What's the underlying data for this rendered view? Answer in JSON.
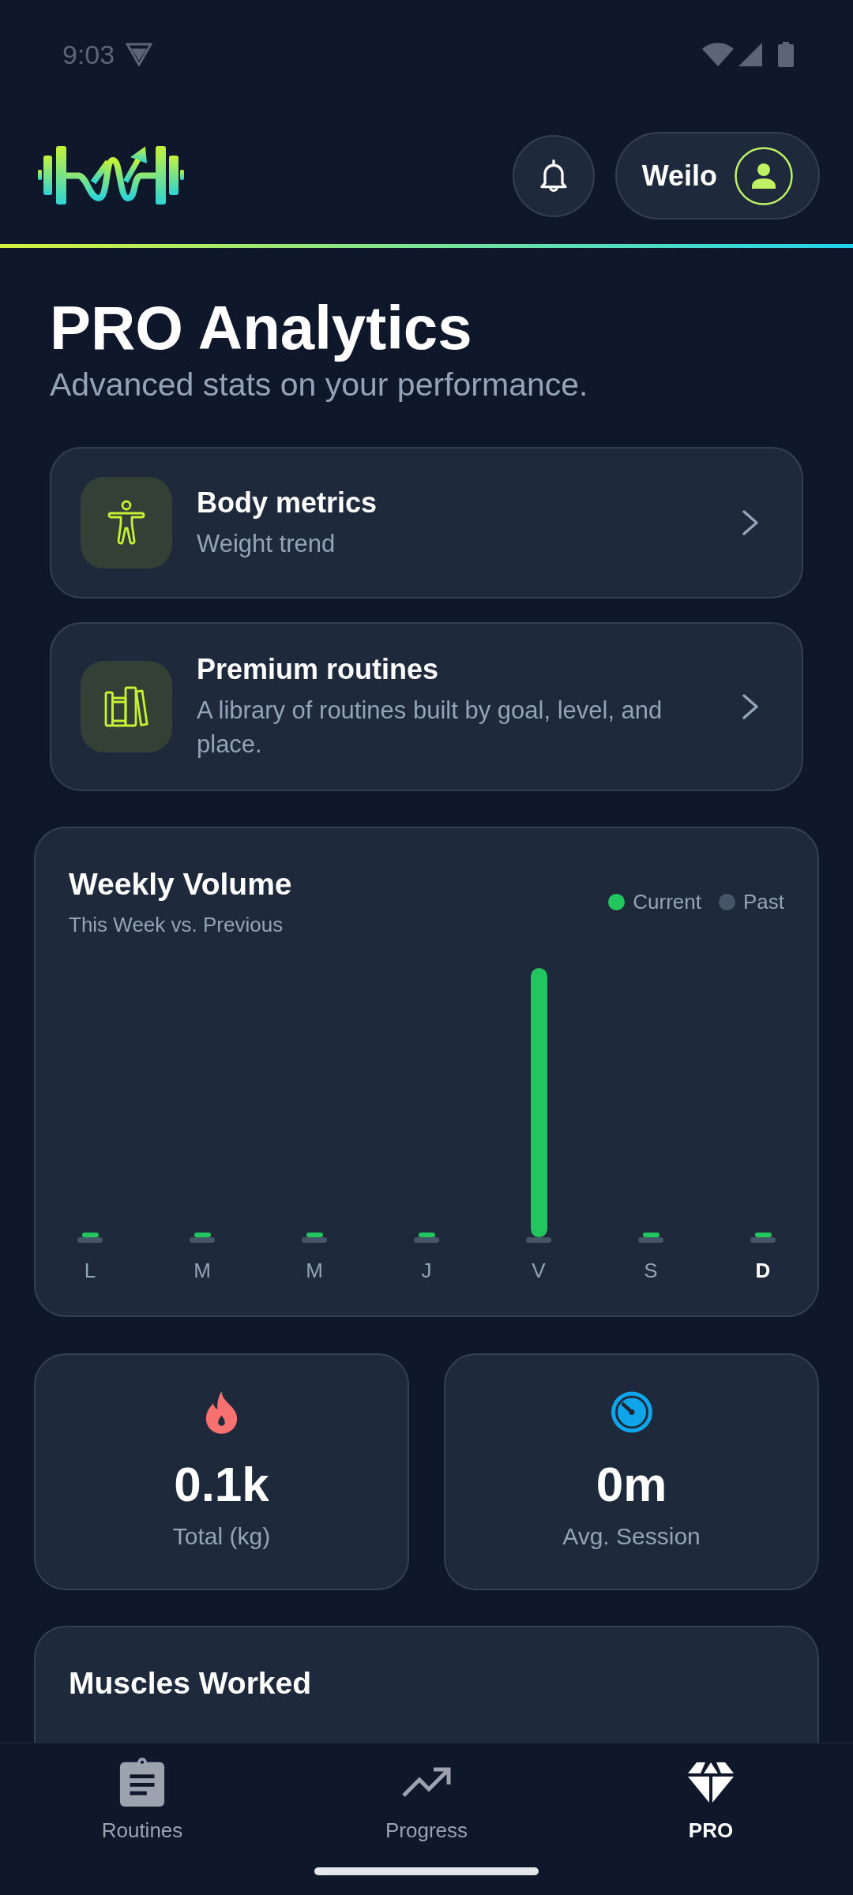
{
  "status_bar": {
    "time": "9:03"
  },
  "header": {
    "user_name": "Weilo"
  },
  "page": {
    "title": "PRO Analytics",
    "subtitle": "Advanced stats on your performance."
  },
  "features": [
    {
      "kind": "body",
      "title": "Body metrics",
      "subtitle": "Weight trend"
    },
    {
      "kind": "library",
      "title": "Premium routines",
      "subtitle": "A library of routines built by goal, level, and place."
    }
  ],
  "weekly_volume": {
    "title": "Weekly Volume",
    "subtitle": "This Week vs. Previous",
    "legend": [
      {
        "label": "Current",
        "color": "#22c55e"
      },
      {
        "label": "Past",
        "color": "#475569"
      }
    ],
    "days": [
      {
        "label": "L",
        "today": false
      },
      {
        "label": "M",
        "today": false
      },
      {
        "label": "M",
        "today": false
      },
      {
        "label": "J",
        "today": false
      },
      {
        "label": "V",
        "today": false
      },
      {
        "label": "S",
        "today": false
      },
      {
        "label": "D",
        "today": true
      }
    ]
  },
  "stats": [
    {
      "kind": "flame",
      "value": "0.1k",
      "label": "Total (kg)"
    },
    {
      "kind": "timer",
      "value": "0m",
      "label": "Avg. Session"
    }
  ],
  "muscles": {
    "title": "Muscles Worked"
  },
  "bottom_nav": [
    {
      "kind": "routines",
      "label": "Routines",
      "selected": false
    },
    {
      "kind": "progress",
      "label": "Progress",
      "selected": false
    },
    {
      "kind": "pro",
      "label": "PRO",
      "selected": true
    }
  ]
}
